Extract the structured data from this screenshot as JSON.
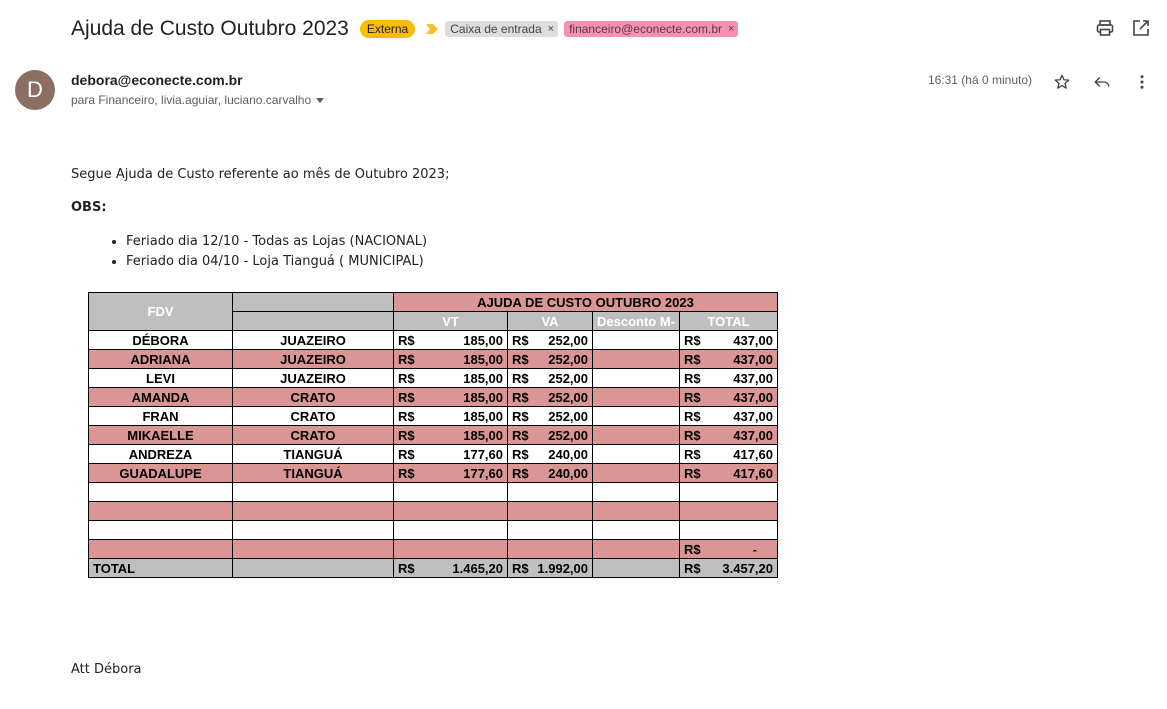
{
  "header": {
    "subject": "Ajuda de Custo Outubro 2023",
    "badge": "Externa",
    "labels": [
      {
        "text": "Caixa de entrada",
        "close": "×"
      },
      {
        "text": "financeiro@econecte.com.br",
        "close": "×"
      }
    ]
  },
  "message": {
    "avatar_letter": "D",
    "sender": "debora@econecte.com.br",
    "recipients": "para Financeiro, livia.aguiar, luciano.carvalho",
    "time": "16:31 (há 0 minuto)",
    "intro": "Segue Ajuda de Custo referente ao mês de Outubro 2023;",
    "obs_label": "OBS:",
    "bullets": [
      "Feriado dia 12/10 - Todas as Lojas (NACIONAL)",
      "Feriado dia 04/10 - Loja Tianguá ( MUNICIPAL)"
    ],
    "signature": "Att Débora"
  },
  "table": {
    "title": "AJUDA DE CUSTO OUTUBRO 2023",
    "col_fdv": "FDV",
    "col_vt": "VT",
    "col_va": "VA",
    "col_desc": "Desconto M-",
    "col_total": "TOTAL",
    "currency": "R$",
    "rows": [
      {
        "name": "DÉBORA",
        "city": "JUAZEIRO",
        "vt": "185,00",
        "va": "252,00",
        "total": "437,00"
      },
      {
        "name": "ADRIANA",
        "city": "JUAZEIRO",
        "vt": "185,00",
        "va": "252,00",
        "total": "437,00"
      },
      {
        "name": "LEVI",
        "city": "JUAZEIRO",
        "vt": "185,00",
        "va": "252,00",
        "total": "437,00"
      },
      {
        "name": "AMANDA",
        "city": "CRATO",
        "vt": "185,00",
        "va": "252,00",
        "total": "437,00"
      },
      {
        "name": "FRAN",
        "city": "CRATO",
        "vt": "185,00",
        "va": "252,00",
        "total": "437,00"
      },
      {
        "name": "MIKAELLE",
        "city": "CRATO",
        "vt": "185,00",
        "va": "252,00",
        "total": "437,00"
      },
      {
        "name": "ANDREZA",
        "city": "TIANGUÁ",
        "vt": "177,60",
        "va": "240,00",
        "total": "417,60"
      },
      {
        "name": "GUADALUPE",
        "city": "TIANGUÁ",
        "vt": "177,60",
        "va": "240,00",
        "total": "417,60"
      }
    ],
    "dash_total": "-",
    "total_label": "TOTAL",
    "total_vt": "1.465,20",
    "total_va": "1.992,00",
    "total_total": "3.457,20"
  }
}
